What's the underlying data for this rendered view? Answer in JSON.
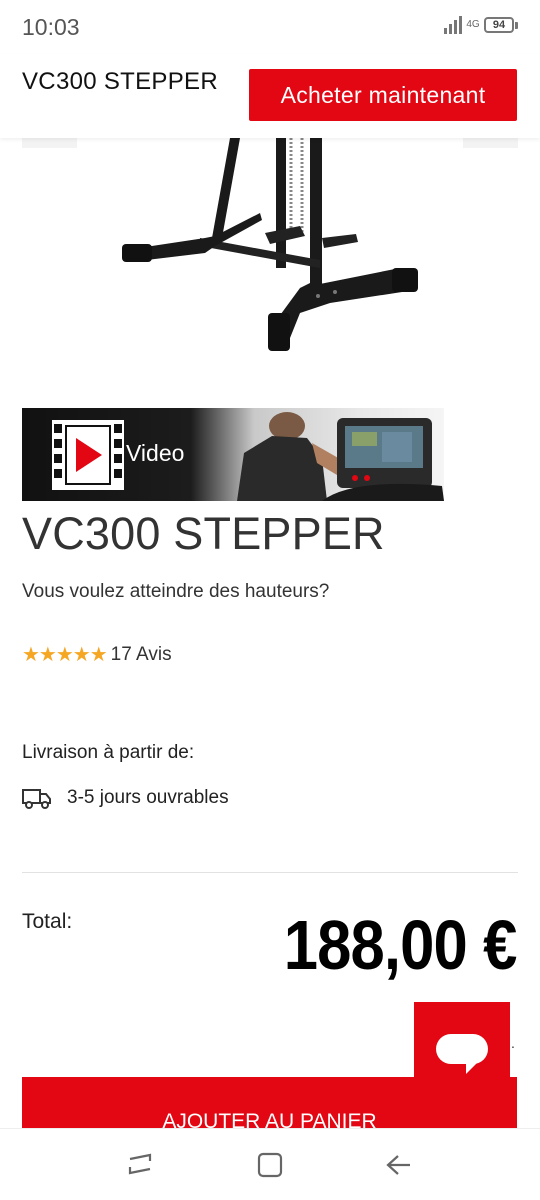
{
  "status_bar": {
    "time": "10:03",
    "network": "4G",
    "battery": "94"
  },
  "header": {
    "title": "VC300 STEPPER",
    "buy_label": "Acheter maintenant"
  },
  "video": {
    "label": "Video"
  },
  "product": {
    "title": "VC300 STEPPER",
    "subtitle": "Vous voulez atteindre des hauteurs?",
    "stars": "★★★★★",
    "reviews": "17 Avis"
  },
  "delivery": {
    "label": "Livraison à partir de:",
    "days": "3-5 jours ouvrables"
  },
  "total": {
    "label": "Total:",
    "price": "188,00 €"
  },
  "cart": {
    "label": "AJOUTER AU PANIER"
  },
  "colors": {
    "brand_red": "#e30613",
    "star": "#f5a623"
  },
  "icons": [
    "signal-icon",
    "battery-icon",
    "play-icon",
    "film-icon",
    "truck-icon",
    "chat-icon",
    "recents-icon",
    "home-icon",
    "back-icon"
  ]
}
